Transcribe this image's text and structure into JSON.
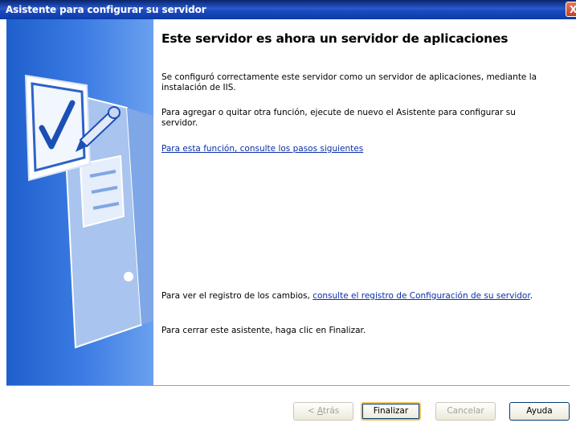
{
  "window": {
    "title": "Asistente para configurar su servidor",
    "close_label": "X"
  },
  "main": {
    "heading": "Este servidor es ahora un servidor de aplicaciones",
    "para1": "Se configuró correctamente este servidor como un servidor de aplicaciones, mediante la instalación de IIS.",
    "para2": "Para agregar o quitar otra función, ejecute de nuevo el Asistente para configurar su servidor.",
    "link_next_steps": "Para esta función, consulte los pasos siguientes",
    "log_prefix": "Para ver el registro de los cambios, ",
    "log_link": "consulte el registro de Configuración de su servidor",
    "log_suffix": ".",
    "close_text": "Para cerrar este asistente, haga clic en Finalizar."
  },
  "buttons": {
    "back_prefix": "< ",
    "back_hotkey": "A",
    "back_rest": "trás",
    "finish": "Finalizar",
    "cancel": "Cancelar",
    "help": "Ayuda"
  },
  "colors": {
    "title_bar": "#0b3ba8",
    "side_panel": "#3a7ae2",
    "link": "#0b2fa8"
  },
  "icons": {
    "illustration": "server-checklist-icon"
  }
}
